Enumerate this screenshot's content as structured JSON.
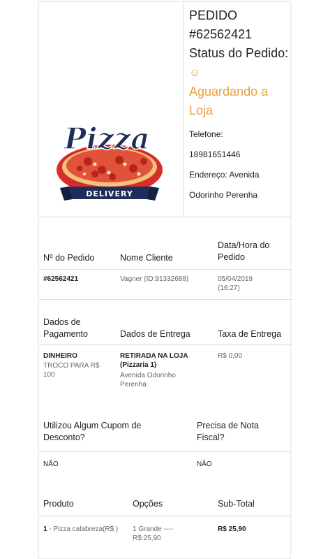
{
  "header": {
    "order_label": "PEDIDO",
    "order_number": "#62562421",
    "status_label": "Status do Pedido:",
    "status_icon": "smile-icon",
    "status_value": "Aguardando a Loja",
    "status_color": "#e6a23c",
    "phone_label": "Telefone:",
    "phone_value": "18981651446",
    "address_text": "Endereço: Avenida Odorinho Perenha"
  },
  "logo": {
    "text": "Pizza",
    "banner": "DELIVERY",
    "colors": {
      "navy": "#1f2d5a",
      "red": "#d72c2c"
    }
  },
  "order_table": {
    "headers": [
      "Nº do Pedido",
      "Nome Cliente",
      "Data/Hora do Pedido"
    ],
    "row": [
      "#62562421",
      "Vagner (ID:91332688)",
      "05/04/2019 (16:27)"
    ]
  },
  "payment_table": {
    "headers": [
      "Dados de Pagamento",
      "Dados de Entrega",
      "Taxa de Entrega"
    ],
    "payment_method": "DINHEIRO",
    "payment_change": "TROCO PARA R$ 100",
    "delivery_type": "RETIRADA NA LOJA (Pizzaria 1)",
    "delivery_address": "Avenida Odorinho Perenha",
    "delivery_fee": "R$ 0,00"
  },
  "coupon_table": {
    "headers": [
      "Utilizou Algum Cupom de Desconto?",
      "Precisa de Nota Fiscal?"
    ],
    "row": [
      "NÃO",
      "NÃO"
    ]
  },
  "products_table": {
    "headers": [
      "Produto",
      "Opções",
      "Sub-Total"
    ],
    "items": [
      {
        "qty": "1",
        "name": "- Pizza calabreza(R$ )",
        "options": "1 Grande ---- R$:25,90",
        "subtotal": "R$ 25,90"
      }
    ]
  }
}
